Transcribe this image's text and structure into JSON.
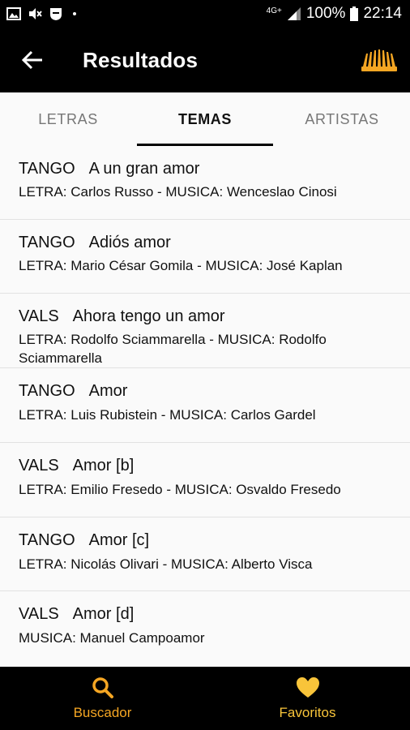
{
  "status": {
    "network": "4G+",
    "battery": "100%",
    "time": "22:14"
  },
  "appbar": {
    "title": "Resultados"
  },
  "tabs": [
    {
      "label": "LETRAS",
      "active": false
    },
    {
      "label": "TEMAS",
      "active": true
    },
    {
      "label": "ARTISTAS",
      "active": false
    }
  ],
  "results": [
    {
      "genre": "TANGO",
      "title": "A un gran amor",
      "credits": "LETRA: Carlos Russo - MUSICA: Wenceslao Cinosi"
    },
    {
      "genre": "TANGO",
      "title": "Adiós amor",
      "credits": "LETRA: Mario César Gomila - MUSICA: José Kaplan"
    },
    {
      "genre": "VALS",
      "title": "Ahora tengo un amor",
      "credits": "LETRA: Rodolfo Sciammarella - MUSICA: Rodolfo Sciammarella"
    },
    {
      "genre": "TANGO",
      "title": "Amor",
      "credits": "LETRA: Luis Rubistein - MUSICA: Carlos Gardel"
    },
    {
      "genre": "VALS",
      "title": "Amor [b]",
      "credits": "LETRA: Emilio Fresedo - MUSICA: Osvaldo Fresedo"
    },
    {
      "genre": "TANGO",
      "title": "Amor [c]",
      "credits": "LETRA: Nicolás Olivari - MUSICA: Alberto Visca"
    },
    {
      "genre": "VALS",
      "title": "Amor [d]",
      "credits": "MUSICA: Manuel Campoamor"
    }
  ],
  "bottom_nav": [
    {
      "label": "Buscador",
      "icon": "search-icon",
      "color": "#f5a623"
    },
    {
      "label": "Favoritos",
      "icon": "heart-icon",
      "color": "#f8c43a"
    }
  ],
  "colors": {
    "accent": "#f5a623",
    "favorites": "#f8c43a",
    "bar": "#000000"
  }
}
